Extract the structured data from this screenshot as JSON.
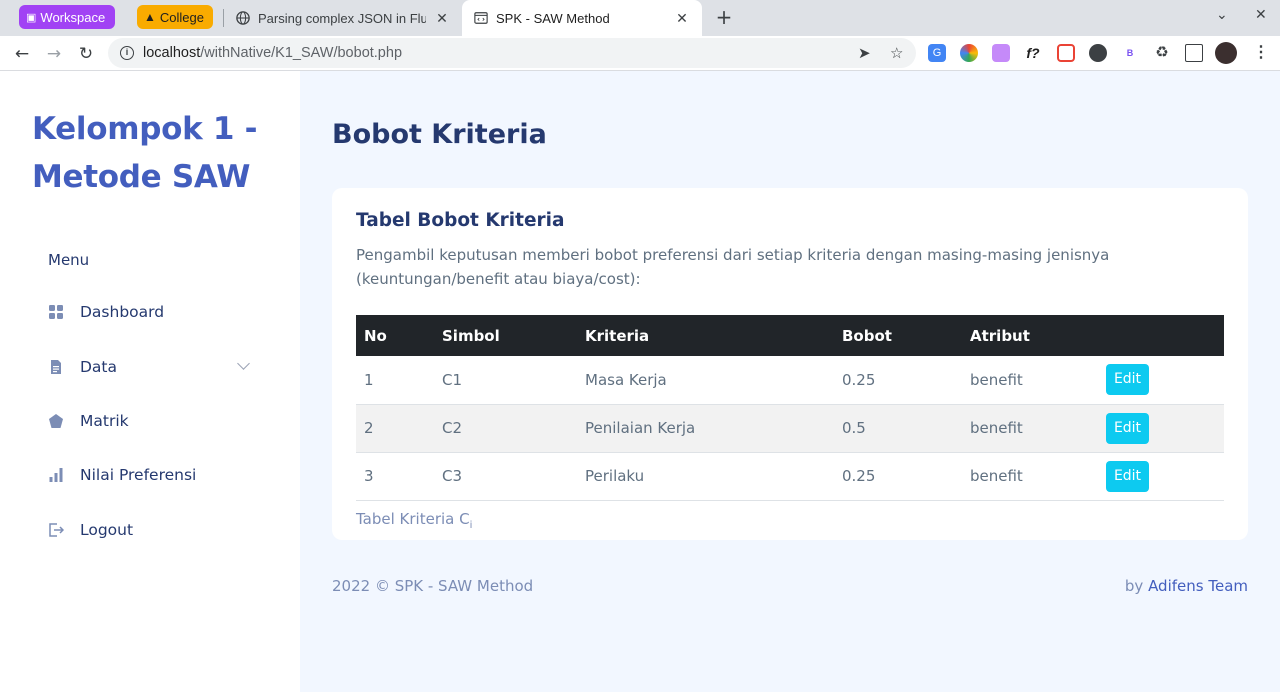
{
  "browser": {
    "tab_groups": [
      {
        "label": "Workspace",
        "color": "#a142f4"
      },
      {
        "label": "College",
        "color": "#f9ab00"
      }
    ],
    "tabs": [
      {
        "title": "Parsing complex JSON in Flutt",
        "active": false
      },
      {
        "title": "SPK - SAW Method",
        "active": true
      }
    ],
    "url_host": "localhost",
    "url_path": "/withNative/K1_SAW/bobot.php"
  },
  "sidebar": {
    "brand": "Kelompok 1 - Metode SAW",
    "menu_title": "Menu",
    "items": [
      {
        "label": "Dashboard",
        "icon": "grid-icon"
      },
      {
        "label": "Data",
        "icon": "file-icon",
        "has_submenu": true
      },
      {
        "label": "Matrik",
        "icon": "pentagon-icon"
      },
      {
        "label": "Nilai Preferensi",
        "icon": "bar-chart-icon"
      },
      {
        "label": "Logout",
        "icon": "logout-icon"
      }
    ]
  },
  "main": {
    "page_title": "Bobot Kriteria",
    "card": {
      "title": "Tabel Bobot Kriteria",
      "description": "Pengambil keputusan memberi bobot preferensi dari setiap kriteria dengan masing-masing jenisnya (keuntungan/benefit atau biaya/cost):",
      "columns": [
        "No",
        "Simbol",
        "Kriteria",
        "Bobot",
        "Atribut",
        ""
      ],
      "rows": [
        {
          "no": "1",
          "simbol": "C1",
          "kriteria": "Masa Kerja",
          "bobot": "0.25",
          "atribut": "benefit",
          "action": "Edit"
        },
        {
          "no": "2",
          "simbol": "C2",
          "kriteria": "Penilaian Kerja",
          "bobot": "0.5",
          "atribut": "benefit",
          "action": "Edit"
        },
        {
          "no": "3",
          "simbol": "C3",
          "kriteria": "Perilaku",
          "bobot": "0.25",
          "atribut": "benefit",
          "action": "Edit"
        }
      ],
      "caption": "Tabel Kriteria C",
      "caption_sub": "i"
    },
    "footer": {
      "left": "2022 © SPK - SAW Method",
      "right_prefix": "by ",
      "right_link": "Adifens Team"
    }
  },
  "colors": {
    "primary": "#435ebe",
    "heading": "#25396f",
    "info_button": "#0dcaf0",
    "main_bg": "#f2f7ff"
  }
}
